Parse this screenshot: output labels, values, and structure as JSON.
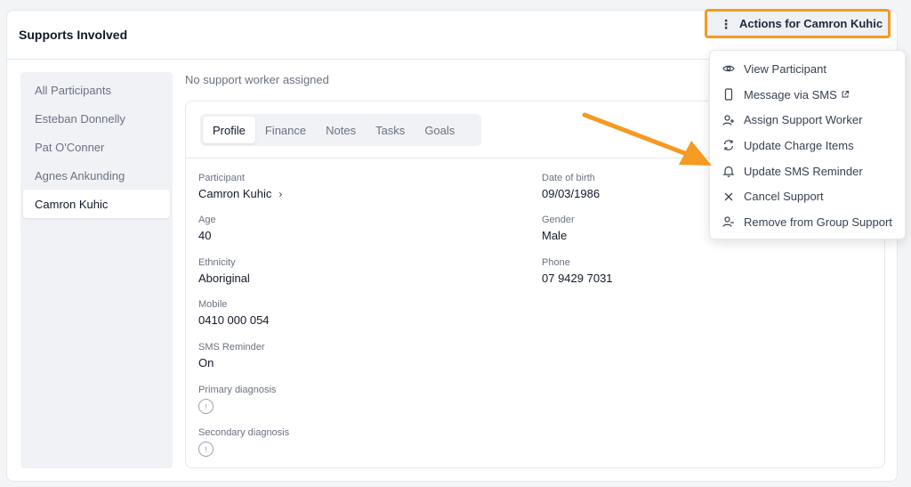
{
  "header": {
    "title": "Supports Involved"
  },
  "actions": {
    "label": "Actions for Camron Kuhic",
    "kebab": "⋮"
  },
  "sidebar": {
    "items": [
      {
        "label": "All Participants"
      },
      {
        "label": "Esteban Donnelly"
      },
      {
        "label": "Pat O'Conner"
      },
      {
        "label": "Agnes Ankunding"
      },
      {
        "label": "Camron Kuhic"
      }
    ],
    "active_index": 4
  },
  "main": {
    "no_worker": "No support worker assigned"
  },
  "tabs": [
    {
      "label": "Profile"
    },
    {
      "label": "Finance"
    },
    {
      "label": "Notes"
    },
    {
      "label": "Tasks"
    },
    {
      "label": "Goals"
    }
  ],
  "profile": {
    "participant_label": "Participant",
    "participant_value": "Camron Kuhic",
    "participant_chevron": "›",
    "dob_label": "Date of birth",
    "dob_value": "09/03/1986",
    "age_label": "Age",
    "age_value": "40",
    "gender_label": "Gender",
    "gender_value": "Male",
    "ethnicity_label": "Ethnicity",
    "ethnicity_value": "Aboriginal",
    "phone_label": "Phone",
    "phone_value": "07 9429 7031",
    "mobile_label": "Mobile",
    "mobile_value": "0410 000 054",
    "sms_label": "SMS Reminder",
    "sms_value": "On",
    "primary_label": "Primary diagnosis",
    "secondary_label": "Secondary diagnosis",
    "diag_glyph": "!"
  },
  "menu": {
    "items": [
      {
        "label": "View Participant",
        "icon": "eye-icon"
      },
      {
        "label": "Message via SMS",
        "icon": "phone-icon"
      },
      {
        "label": "Assign Support Worker",
        "icon": "user-plus-icon"
      },
      {
        "label": "Update Charge Items",
        "icon": "refresh-icon"
      },
      {
        "label": "Update SMS Reminder",
        "icon": "bell-icon"
      },
      {
        "label": "Cancel Support",
        "icon": "x-icon"
      },
      {
        "label": "Remove from Group Support",
        "icon": "user-minus-icon"
      }
    ]
  },
  "colors": {
    "highlight": "#f59a23",
    "accent": "#111827",
    "muted": "#6b7280"
  }
}
